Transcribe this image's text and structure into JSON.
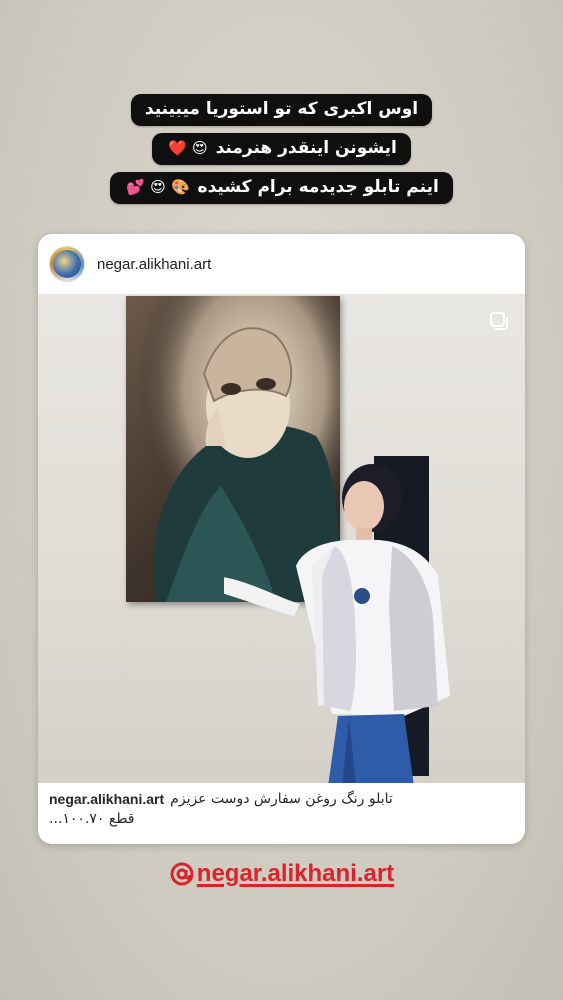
{
  "story_captions": [
    {
      "text": "اوس اکبری که تو استوریا میبینید",
      "emoji": ""
    },
    {
      "text": "ایشونن اینقدر هنرمند",
      "emoji": "😍 ❤️"
    },
    {
      "text": "اینم تابلو جدیدمه برام کشیده",
      "emoji": "🎨 😍 💕"
    }
  ],
  "shared_post": {
    "username": "negar.alikhani.art",
    "caption_user": "negar.alikhani.art",
    "caption_text": "تابلو رنگ روغن سفارش دوست عزیزم",
    "caption_more": "قطع ۱۰۰.۷۰..."
  },
  "mention": {
    "handle": "negar.alikhani.art"
  },
  "colors": {
    "caption_bg": "#0f0f10",
    "mention_red": "#d9242b"
  },
  "icons": {
    "multi_post": "multiple-images-icon",
    "mention": "at-sign-icon"
  }
}
